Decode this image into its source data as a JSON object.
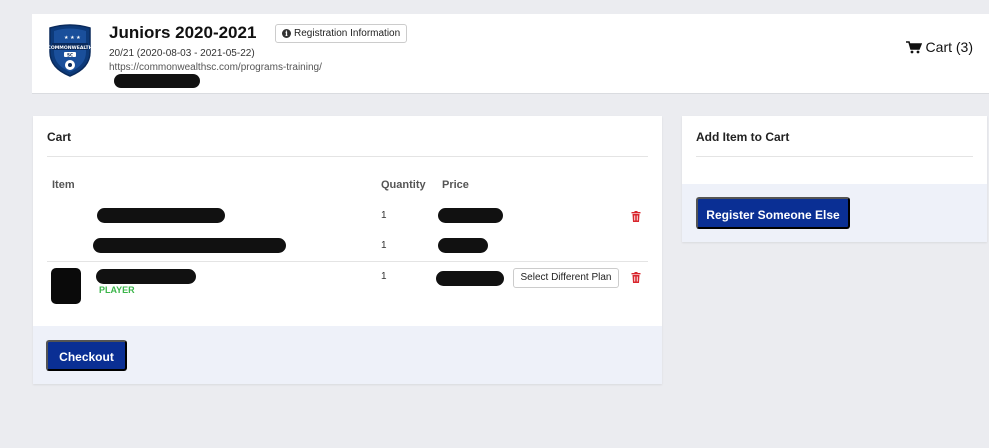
{
  "header": {
    "logo_icon": "club-crest-shield",
    "logo_text": "COMMONWEALTH SC",
    "title": "Juniors 2020-2021",
    "registration_info_label": "Registration Information",
    "season": "20/21 (2020-08-03 - 2021-05-22)",
    "url": "https://commonwealthsc.com/programs-training/",
    "cart_label": "Cart (3)"
  },
  "cart": {
    "title": "Cart",
    "columns": {
      "item": "Item",
      "quantity": "Quantity",
      "price": "Price"
    },
    "items": [
      {
        "quantity": "1"
      },
      {
        "quantity": "1"
      },
      {
        "quantity": "1",
        "tag": "PLAYER",
        "select_plan_label": "Select Different Plan"
      }
    ],
    "checkout_label": "Checkout"
  },
  "add_item": {
    "title": "Add Item to Cart",
    "register_label": "Register Someone Else"
  },
  "colors": {
    "primary": "#0a2f94",
    "player_tag": "#3bb54a",
    "delete": "#d9272e",
    "footer_bg": "#eef1f9"
  }
}
